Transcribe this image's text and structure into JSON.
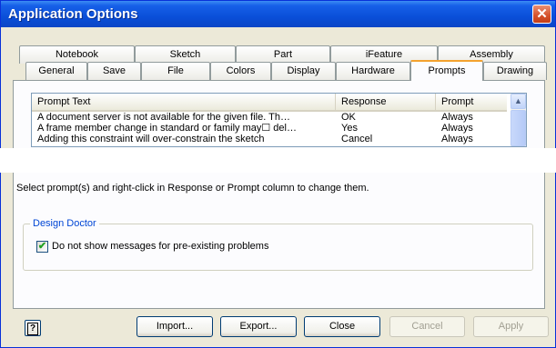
{
  "window": {
    "title": "Application Options",
    "close_symbol": "✕"
  },
  "tabs_row1": [
    {
      "label": "Notebook"
    },
    {
      "label": "Sketch"
    },
    {
      "label": "Part"
    },
    {
      "label": "iFeature"
    },
    {
      "label": "Assembly"
    }
  ],
  "tabs_row2": [
    {
      "label": "General"
    },
    {
      "label": "Save"
    },
    {
      "label": "File"
    },
    {
      "label": "Colors"
    },
    {
      "label": "Display"
    },
    {
      "label": "Hardware"
    },
    {
      "label": "Prompts",
      "active": true
    },
    {
      "label": "Drawing"
    }
  ],
  "prompts_list": {
    "columns": [
      "Prompt Text",
      "Response",
      "Prompt"
    ],
    "rows": [
      {
        "text": "A document server is not available for the given file.  Th…",
        "response": "OK",
        "prompt": "Always"
      },
      {
        "text": "A frame member change in standard or family may☐ del…",
        "response": "Yes",
        "prompt": "Always"
      },
      {
        "text": "Adding this constraint will over-constrain the sketch",
        "response": "Cancel",
        "prompt": "Always"
      }
    ]
  },
  "hint_text": "Select prompt(s) and right-click in Response or Prompt column to change them.",
  "design_doctor": {
    "title": "Design Doctor",
    "checkbox_label": "Do not show messages for pre-existing problems",
    "checked": true
  },
  "buttons": {
    "help": "?",
    "import": "Import...",
    "export": "Export...",
    "close": "Close",
    "cancel": "Cancel",
    "apply": "Apply"
  }
}
